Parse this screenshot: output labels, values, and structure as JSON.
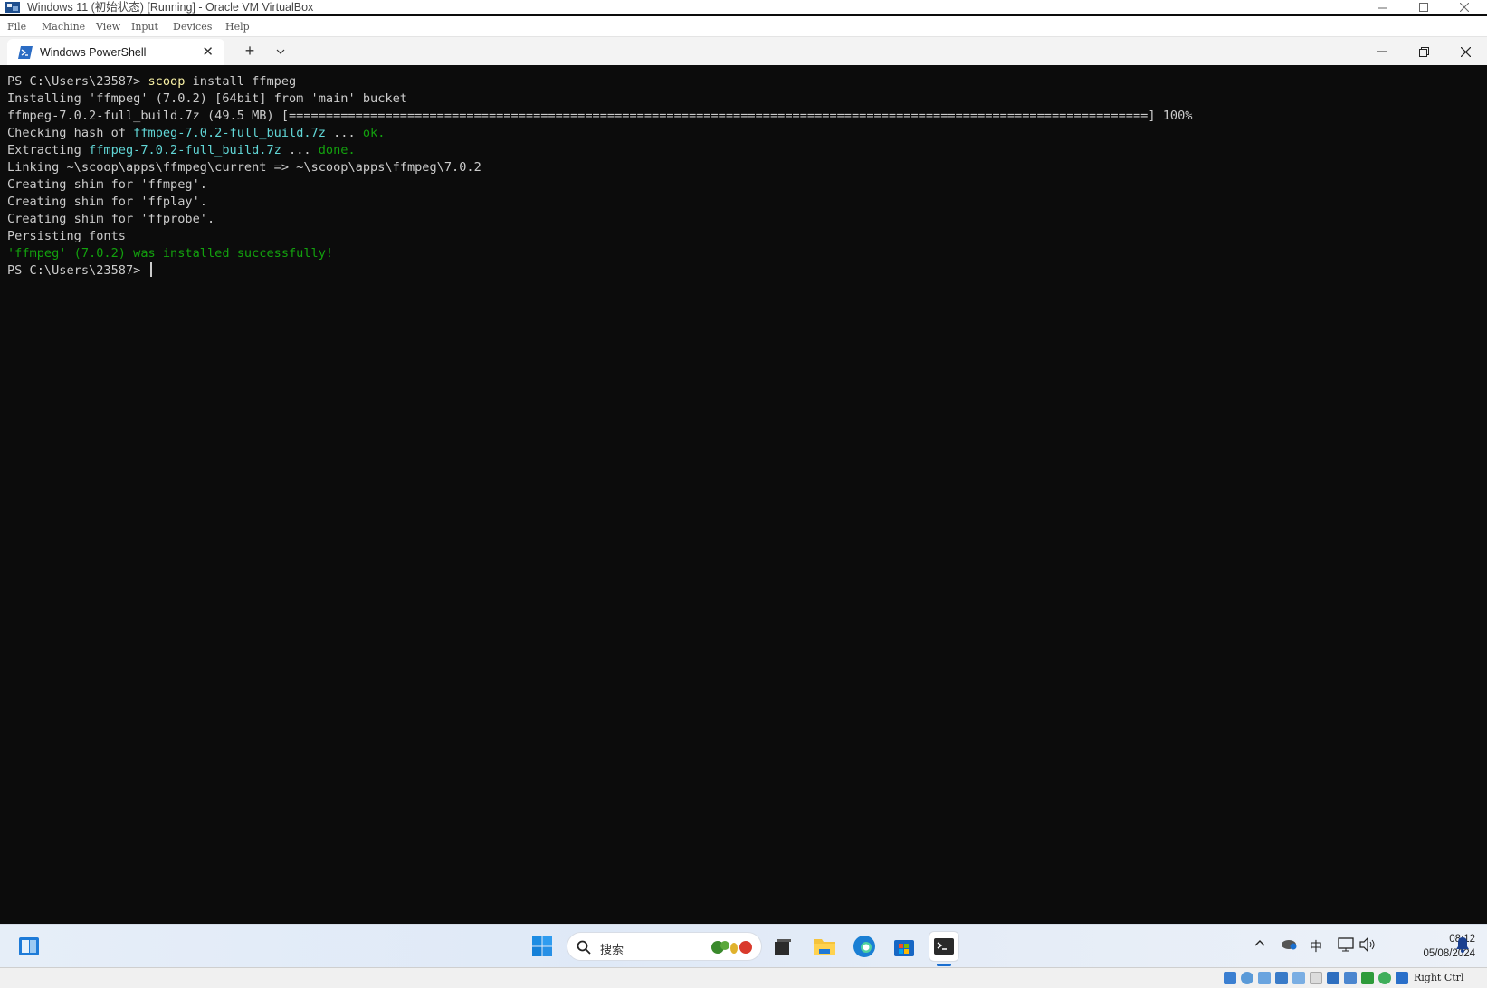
{
  "vbox": {
    "title": "Windows 11 (初始状态) [Running] - Oracle VM VirtualBox",
    "menu": [
      "File",
      "Machine",
      "View",
      "Input",
      "Devices",
      "Help"
    ],
    "host_key": "Right Ctrl"
  },
  "terminal": {
    "tab_label": "Windows PowerShell",
    "lines": {
      "l1_prompt": "PS C:\\Users\\23587> ",
      "l1_cmd": "scoop",
      "l1_args": " install ffmpeg",
      "l2": "Installing 'ffmpeg' (7.0.2) [64bit] from 'main' bucket",
      "l3": "ffmpeg-7.0.2-full_build.7z (49.5 MB) [====================================================================================================================] 100%",
      "l4_pre": "Checking hash of ",
      "l4_file": "ffmpeg-7.0.2-full_build.7z",
      "l4_dots": " ... ",
      "l4_ok": "ok.",
      "l5_pre": "Extracting ",
      "l5_file": "ffmpeg-7.0.2-full_build.7z",
      "l5_dots": " ... ",
      "l5_done": "done.",
      "l6": "Linking ~\\scoop\\apps\\ffmpeg\\current => ~\\scoop\\apps\\ffmpeg\\7.0.2",
      "l7": "Creating shim for 'ffmpeg'.",
      "l8": "Creating shim for 'ffplay'.",
      "l9": "Creating shim for 'ffprobe'.",
      "l10": "Persisting fonts",
      "l11": "'ffmpeg' (7.0.2) was installed successfully!",
      "l12_prompt": "PS C:\\Users\\23587> "
    }
  },
  "taskbar": {
    "search_placeholder": "搜索",
    "ime": "中",
    "time": "08:12",
    "date": "05/08/2024"
  },
  "colors": {
    "console_bg": "#0c0c0c",
    "console_fg": "#cccccc",
    "command_yellow": "#f9f1a5",
    "path_cyan": "#61d6d6",
    "success_green": "#13a10e"
  }
}
